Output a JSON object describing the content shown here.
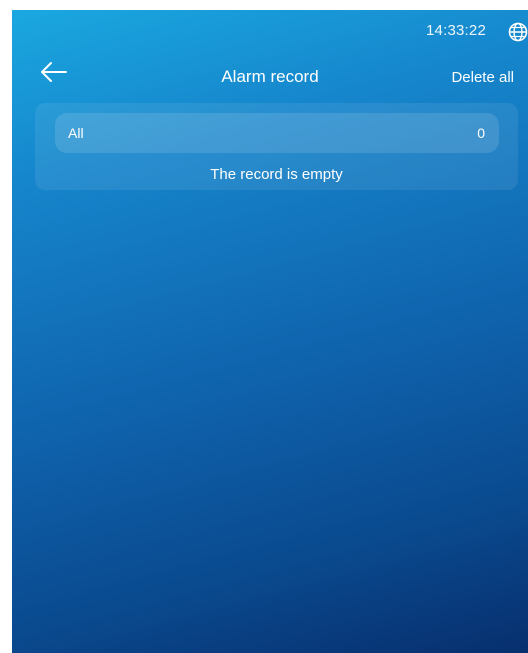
{
  "status_bar": {
    "time": "14:33:22",
    "globe_icon": "globe-icon"
  },
  "header": {
    "back_icon": "arrow-left-icon",
    "title": "Alarm record",
    "delete_all_label": "Delete all"
  },
  "records": {
    "filter": {
      "label": "All",
      "count": "0"
    },
    "empty_message": "The record is empty"
  },
  "colors": {
    "gradient_top": "#1aa8e0",
    "gradient_bottom": "#072f6e",
    "text": "#ffffff"
  }
}
